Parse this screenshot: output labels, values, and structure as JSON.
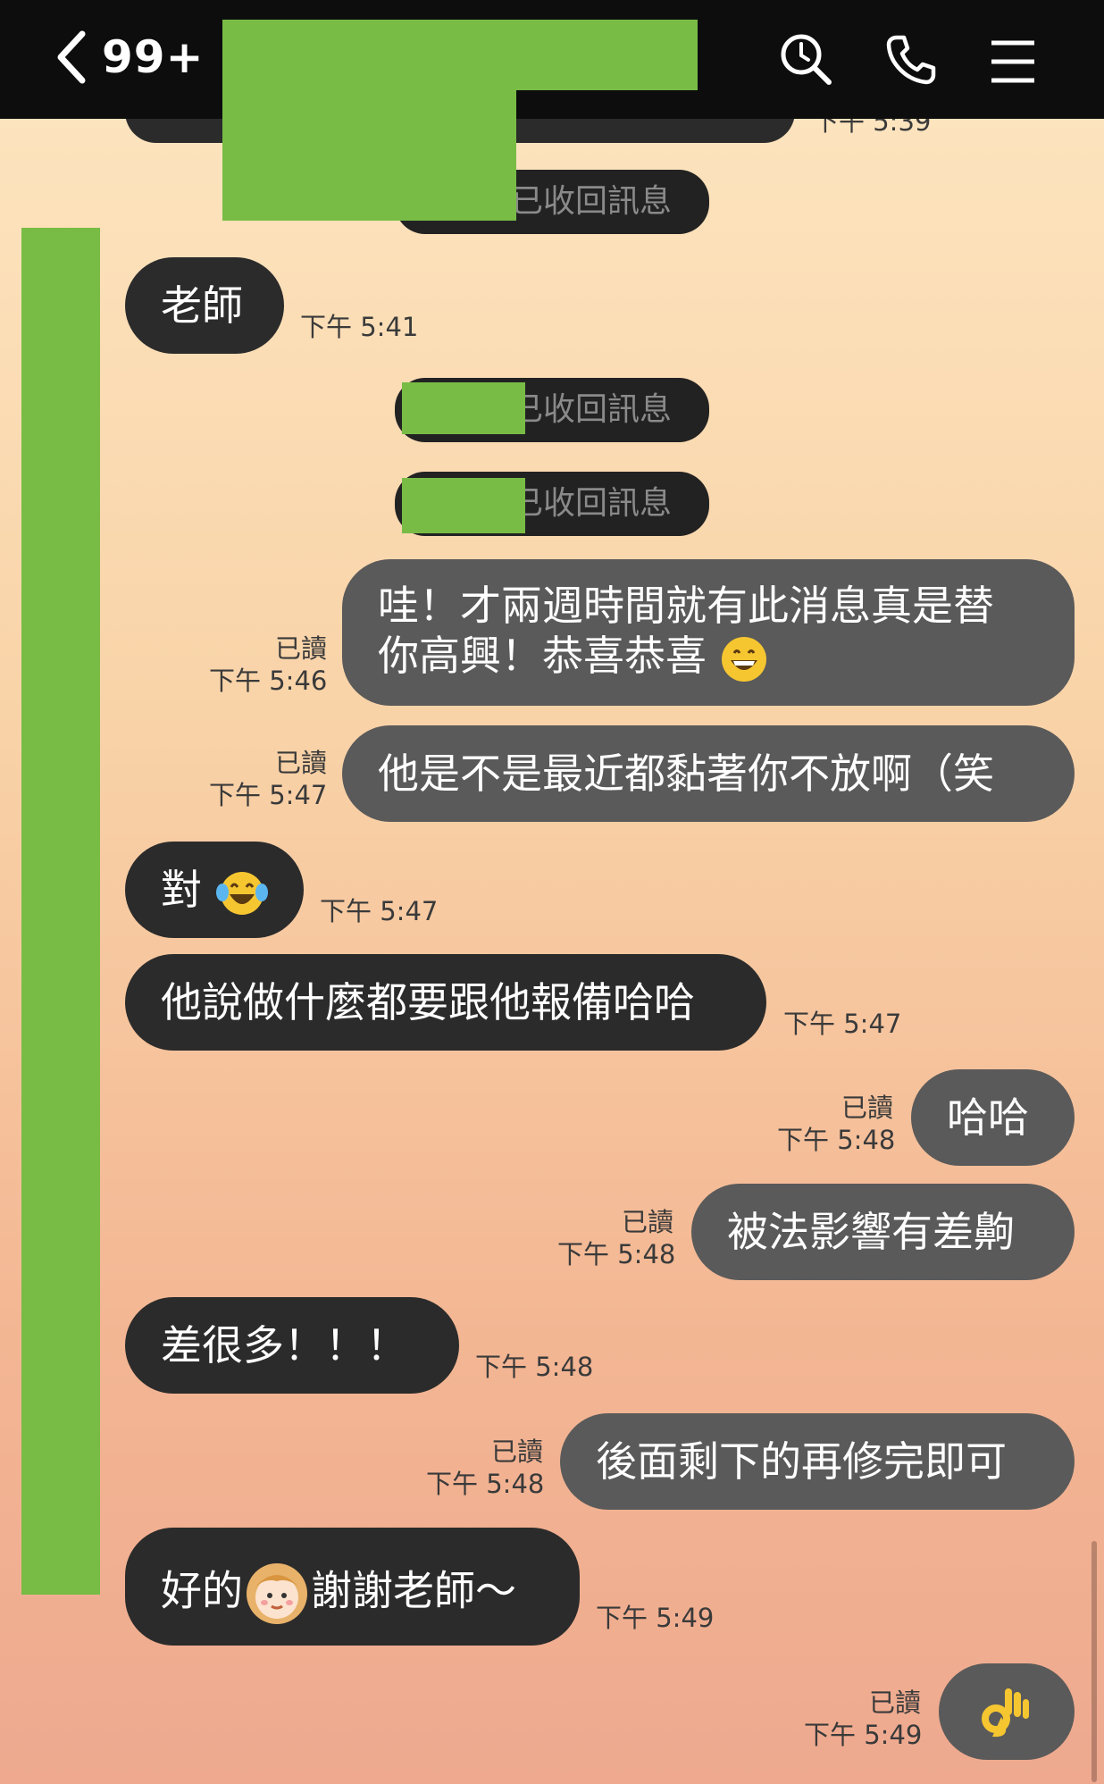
{
  "header": {
    "back_count": "99+",
    "icons": [
      "back-chevron-icon",
      "search-icon",
      "phone-icon",
      "menu-icon"
    ]
  },
  "colors": {
    "header_bg": "#0d0d0d",
    "incoming_bubble": "#2b2b2b",
    "outgoing_bubble": "#5a5a5a",
    "redaction": "#78bc45"
  },
  "messages": {
    "prev_time_partial": "下午 5:39",
    "recalled_1": "已收回訊息",
    "m1": {
      "text": "老師",
      "time": "下午 5:41"
    },
    "recalled_2": "已收回訊息",
    "recalled_3": "已收回訊息",
    "m2": {
      "line1": "哇！才兩週時間就有此消息真是替",
      "line2": "你高興！恭喜恭喜",
      "read": "已讀",
      "time": "下午 5:46"
    },
    "m3": {
      "text": "他是不是最近都黏著你不放啊（笑",
      "read": "已讀",
      "time": "下午 5:47"
    },
    "m4": {
      "text": "對",
      "time": "下午 5:47"
    },
    "m5": {
      "text": "他說做什麼都要跟他報備哈哈",
      "time": "下午 5:47"
    },
    "m6": {
      "text": "哈哈",
      "read": "已讀",
      "time": "下午 5:48"
    },
    "m7": {
      "text": "被法影響有差齁",
      "read": "已讀",
      "time": "下午 5:48"
    },
    "m8": {
      "text": "差很多！！！",
      "time": "下午 5:48"
    },
    "m9": {
      "text": "後面剩下的再修完即可",
      "read": "已讀",
      "time": "下午 5:48"
    },
    "m10": {
      "text_a": "好的",
      "text_b": "謝謝老師～",
      "time": "下午 5:49"
    },
    "m11": {
      "emoji": "ok-hand-emoji",
      "read": "已讀",
      "time": "下午 5:49"
    }
  }
}
